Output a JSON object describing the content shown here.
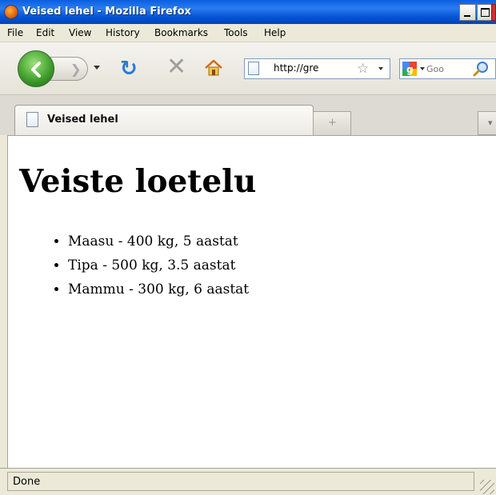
{
  "window": {
    "title": "Veised lehel - Mozilla Firefox",
    "app_icon": "firefox-icon",
    "buttons": [
      "minimize",
      "maximize",
      "close"
    ]
  },
  "menubar": {
    "items": [
      "File",
      "Edit",
      "View",
      "History",
      "Bookmarks",
      "Tools",
      "Help"
    ]
  },
  "toolbar": {
    "back_icon": "back-arrow-icon",
    "forward_icon": "forward-arrow-icon",
    "reload_icon": "reload-icon",
    "stop_icon": "stop-icon",
    "home_icon": "home-icon",
    "url": "http://gre",
    "bookmark_icon": "star-icon",
    "search_engine_icon": "google-icon",
    "search_placeholder": "Goo",
    "search_go_icon": "magnifier-icon"
  },
  "tabs": [
    {
      "label": "Veised lehel",
      "active": true
    }
  ],
  "page": {
    "heading": "Veiste loetelu",
    "items": [
      "Maasu - 400 kg, 5 aastat",
      "Tipa - 500 kg, 3.5 aastat",
      "Mammu - 300 kg, 6 aastat"
    ]
  },
  "statusbar": {
    "text": "Done"
  },
  "colors": {
    "titlebar": "#0a5fe0",
    "chrome": "#ece9d8",
    "reload": "#2a7ad6",
    "back_button": "#3a9a28"
  }
}
